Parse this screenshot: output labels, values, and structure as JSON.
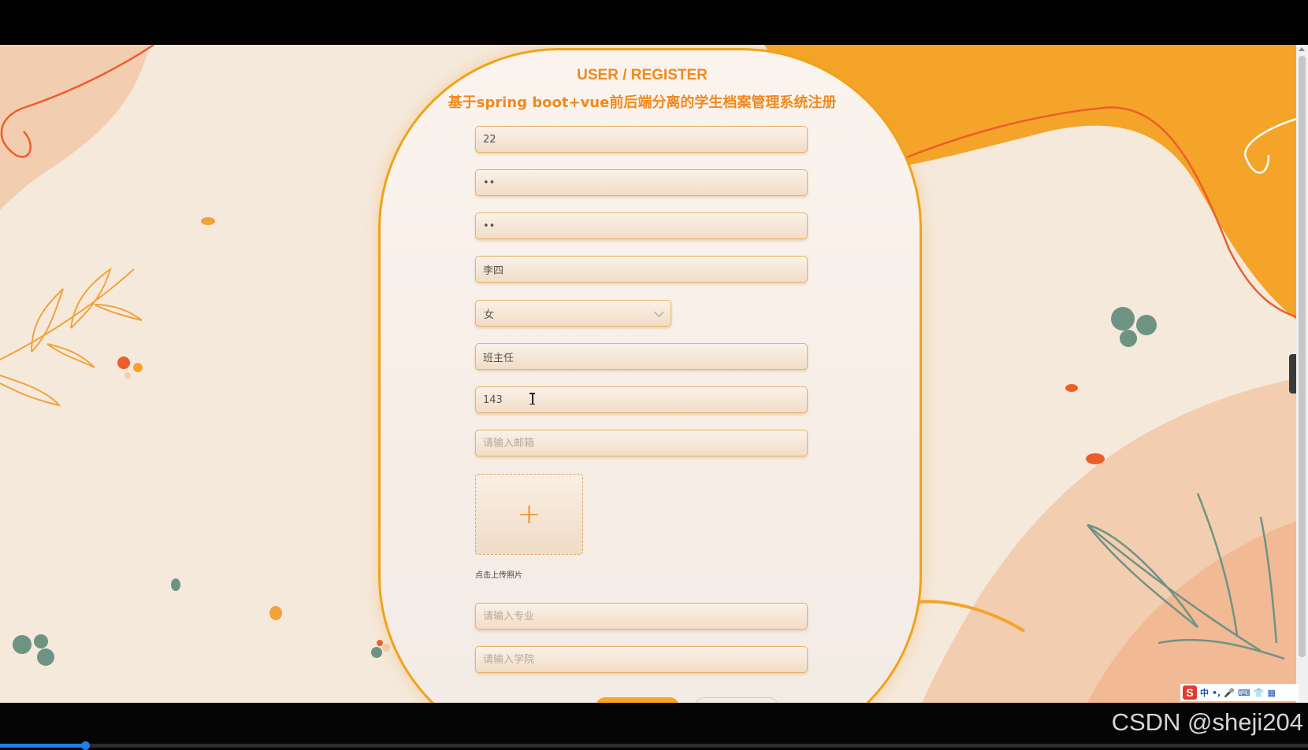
{
  "page": {
    "title_en": "USER / REGISTER",
    "title_cn": "基于spring boot+vue前后端分离的学生档案管理系统注册"
  },
  "form": {
    "fields": [
      {
        "name": "username",
        "value": "22",
        "placeholder": ""
      },
      {
        "name": "password",
        "value": "••",
        "placeholder": ""
      },
      {
        "name": "confirm_password",
        "value": "••",
        "placeholder": ""
      },
      {
        "name": "real_name",
        "value": "李四",
        "placeholder": ""
      },
      {
        "name": "position",
        "value": "班主任",
        "placeholder": ""
      },
      {
        "name": "phone",
        "value": "143",
        "placeholder": ""
      },
      {
        "name": "email",
        "value": "",
        "placeholder": "请输入邮箱"
      },
      {
        "name": "major",
        "value": "",
        "placeholder": "请输入专业"
      },
      {
        "name": "college",
        "value": "",
        "placeholder": "请输入学院"
      }
    ],
    "gender_select": {
      "value": "女"
    },
    "upload": {
      "icon": "plus-icon",
      "label": "点击上传照片"
    }
  },
  "ime": {
    "logo": "S",
    "items": [
      "中",
      "•,",
      "🎤",
      "⌨",
      "👕",
      "▦"
    ]
  },
  "watermark": "CSDN @sheji204",
  "video": {
    "progress": 0.065
  },
  "colors": {
    "accent": "#f0891e",
    "button": "#f4a71f",
    "border": "#f0a21b"
  }
}
